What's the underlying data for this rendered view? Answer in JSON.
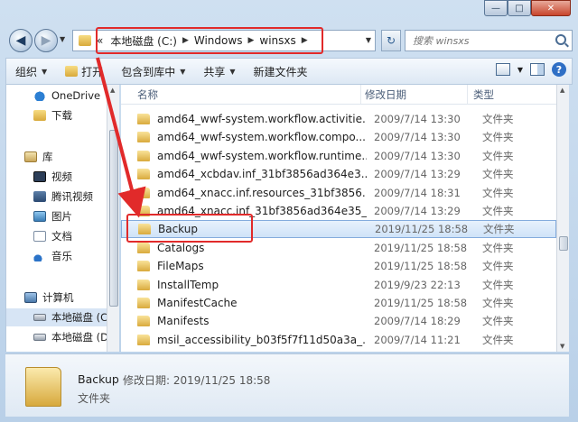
{
  "window_controls": {
    "minimize": "—",
    "maximize": "□",
    "close": "✕"
  },
  "address": {
    "chevrons": "«",
    "segments": [
      "本地磁盘 (C:)",
      "Windows",
      "winsxs"
    ],
    "separator": "▶"
  },
  "search": {
    "placeholder": "搜索 winsxs"
  },
  "toolbar": {
    "organize": "组织",
    "open": "打开",
    "include_library": "包含到库中",
    "share": "共享",
    "new_folder": "新建文件夹"
  },
  "nav": {
    "onedrive": "OneDrive",
    "downloads": "下载",
    "libraries": "库",
    "videos": "视频",
    "tencent_video": "腾讯视频",
    "pictures": "图片",
    "documents": "文档",
    "music": "音乐",
    "computer": "计算机",
    "local_c": "本地磁盘 (C",
    "local_d": "本地磁盘 (D"
  },
  "columns": {
    "name": "名称",
    "date": "修改日期",
    "type": "类型"
  },
  "rows": [
    {
      "name": "amd64_wwf-system.workflow.activitie...",
      "date": "2009/7/14 13:30",
      "type": "文件夹"
    },
    {
      "name": "amd64_wwf-system.workflow.compo...",
      "date": "2009/7/14 13:30",
      "type": "文件夹"
    },
    {
      "name": "amd64_wwf-system.workflow.runtime...",
      "date": "2009/7/14 13:30",
      "type": "文件夹"
    },
    {
      "name": "amd64_xcbdav.inf_31bf3856ad364e3...",
      "date": "2009/7/14 13:29",
      "type": "文件夹"
    },
    {
      "name": "amd64_xnacc.inf.resources_31bf3856...",
      "date": "2009/7/14 18:31",
      "type": "文件夹"
    },
    {
      "name": "amd64_xnacc.inf_31bf3856ad364e35_...",
      "date": "2009/7/14 13:29",
      "type": "文件夹"
    },
    {
      "name": "Backup",
      "date": "2019/11/25 18:58",
      "type": "文件夹"
    },
    {
      "name": "Catalogs",
      "date": "2019/11/25 18:58",
      "type": "文件夹"
    },
    {
      "name": "FileMaps",
      "date": "2019/11/25 18:58",
      "type": "文件夹"
    },
    {
      "name": "InstallTemp",
      "date": "2019/9/23 22:13",
      "type": "文件夹"
    },
    {
      "name": "ManifestCache",
      "date": "2019/11/25 18:58",
      "type": "文件夹"
    },
    {
      "name": "Manifests",
      "date": "2009/7/14 18:29",
      "type": "文件夹"
    },
    {
      "name": "msil_accessibility_b03f5f7f11d50a3a_...",
      "date": "2009/7/14 11:21",
      "type": "文件夹"
    }
  ],
  "details": {
    "name": "Backup",
    "meta": "修改日期: 2019/11/25 18:58",
    "type": "文件夹"
  },
  "colors": {
    "highlight": "#e12a2a",
    "selection": "#cfe3f8"
  }
}
